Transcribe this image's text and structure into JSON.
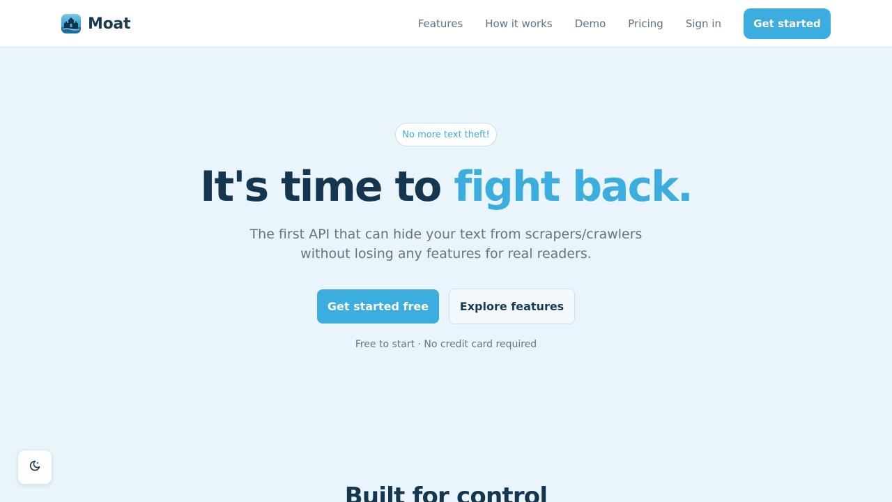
{
  "colors": {
    "accent": "#3badde",
    "heading": "#143650",
    "muted": "#5e7688",
    "background": "#eaf5fb"
  },
  "header": {
    "brand": {
      "name": "Moat",
      "logo_icon": "moat-castle-logo-icon"
    },
    "nav": [
      {
        "label": "Features"
      },
      {
        "label": "How it works"
      },
      {
        "label": "Demo"
      },
      {
        "label": "Pricing"
      },
      {
        "label": "Sign in"
      }
    ],
    "cta_label": "Get started"
  },
  "hero": {
    "badge": "No more text theft!",
    "title_main": "It's time to ",
    "title_accent": "fight back.",
    "subtitle_line1": "The first API that can hide your text from scrapers/crawlers",
    "subtitle_line2": "without losing any features for real readers.",
    "primary_button": "Get started free",
    "secondary_button": "Explore features",
    "note": "Free to start · No credit card required"
  },
  "theme_toggle": {
    "icon": "moon-sparkle-icon"
  },
  "next_section": {
    "title": "Built for control"
  }
}
